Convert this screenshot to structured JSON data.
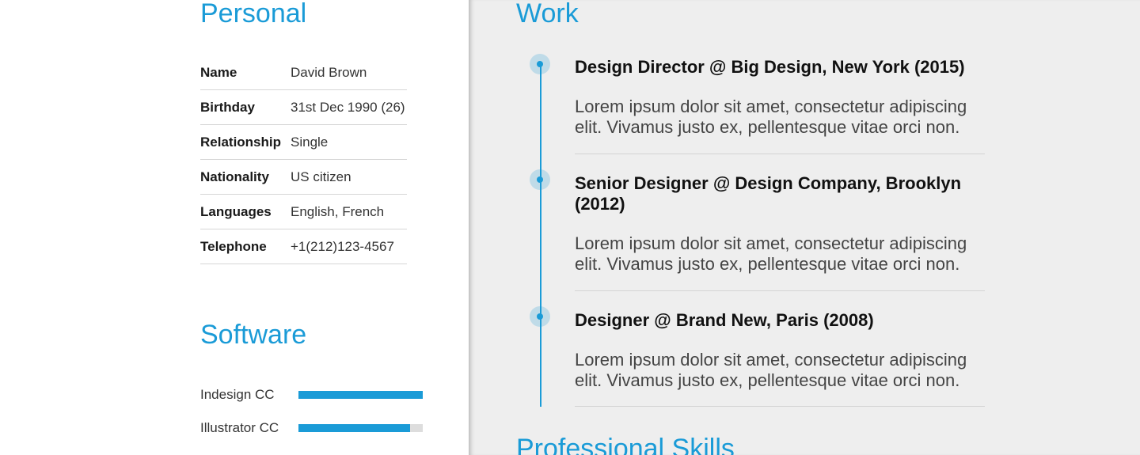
{
  "personal": {
    "title": "Personal",
    "rows": [
      {
        "label": "Name",
        "value": "David Brown"
      },
      {
        "label": "Birthday",
        "value": "31st Dec 1990 (26)"
      },
      {
        "label": "Relationship",
        "value": "Single"
      },
      {
        "label": "Nationality",
        "value": "US citizen"
      },
      {
        "label": "Languages",
        "value": "English, French"
      },
      {
        "label": "Telephone",
        "value": "+1(212)123-4567"
      }
    ]
  },
  "software": {
    "title": "Software",
    "items": [
      {
        "label": "Indesign CC",
        "level": 1.0
      },
      {
        "label": "Illustrator CC",
        "level": 0.9
      }
    ]
  },
  "work": {
    "title": "Work",
    "jobs": [
      {
        "title": "Design Director @ Big Design, New York (2015)",
        "description": "Lorem ipsum dolor sit amet, consectetur adipiscing elit. Vivamus justo ex, pellentesque vitae orci non."
      },
      {
        "title": "Senior Designer @ Design Company, Brooklyn (2012)",
        "description": "Lorem ipsum dolor sit amet, consectetur adipiscing elit. Vivamus justo ex, pellentesque vitae orci non."
      },
      {
        "title": "Designer @ Brand New, Paris (2008)",
        "description": "Lorem ipsum dolor sit amet, consectetur adipiscing elit. Vivamus justo ex, pellentesque vitae orci non."
      }
    ]
  },
  "professional_skills": {
    "title": "Professional Skills"
  },
  "colors": {
    "accent": "#1a9bd7",
    "right_background": "#eeeeee"
  }
}
